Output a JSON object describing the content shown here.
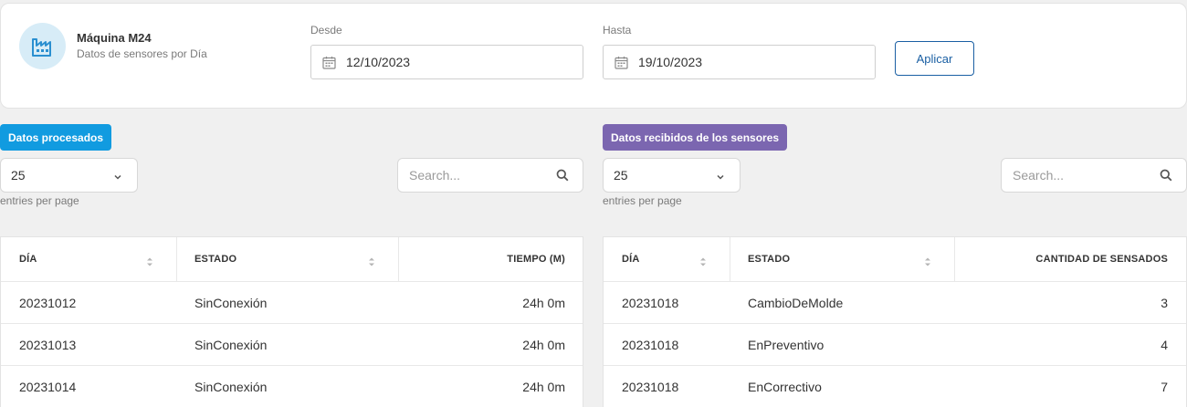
{
  "header": {
    "machine_name": "Máquina M24",
    "subtitle": "Datos de sensores por Día",
    "icon": "factory-icon",
    "from_label": "Desde",
    "from_value": "12/10/2023",
    "to_label": "Hasta",
    "to_value": "19/10/2023",
    "apply_label": "Aplicar"
  },
  "left_panel": {
    "badge": "Datos procesados",
    "page_size": "25",
    "entries_label": "entries per page",
    "search_placeholder": "Search...",
    "columns": [
      "DÍA",
      "ESTADO",
      "TIEMPO (M)"
    ],
    "rows": [
      {
        "dia": "20231012",
        "estado": "SinConexión",
        "tiempo": "24h 0m"
      },
      {
        "dia": "20231013",
        "estado": "SinConexión",
        "tiempo": "24h 0m"
      },
      {
        "dia": "20231014",
        "estado": "SinConexión",
        "tiempo": "24h 0m"
      }
    ]
  },
  "right_panel": {
    "badge": "Datos recibidos de los sensores",
    "page_size": "25",
    "entries_label": "entries per page",
    "search_placeholder": "Search...",
    "columns": [
      "DÍA",
      "ESTADO",
      "CANTIDAD DE SENSADOS"
    ],
    "rows": [
      {
        "dia": "20231018",
        "estado": "CambioDeMolde",
        "cantidad": "3"
      },
      {
        "dia": "20231018",
        "estado": "EnPreventivo",
        "cantidad": "4"
      },
      {
        "dia": "20231018",
        "estado": "EnCorrectivo",
        "cantidad": "7"
      }
    ]
  },
  "colors": {
    "accent_blue": "#119be0",
    "accent_purple": "#7b66b0",
    "button_blue": "#1a5fa3",
    "icon_bg": "#d7ecf7"
  }
}
